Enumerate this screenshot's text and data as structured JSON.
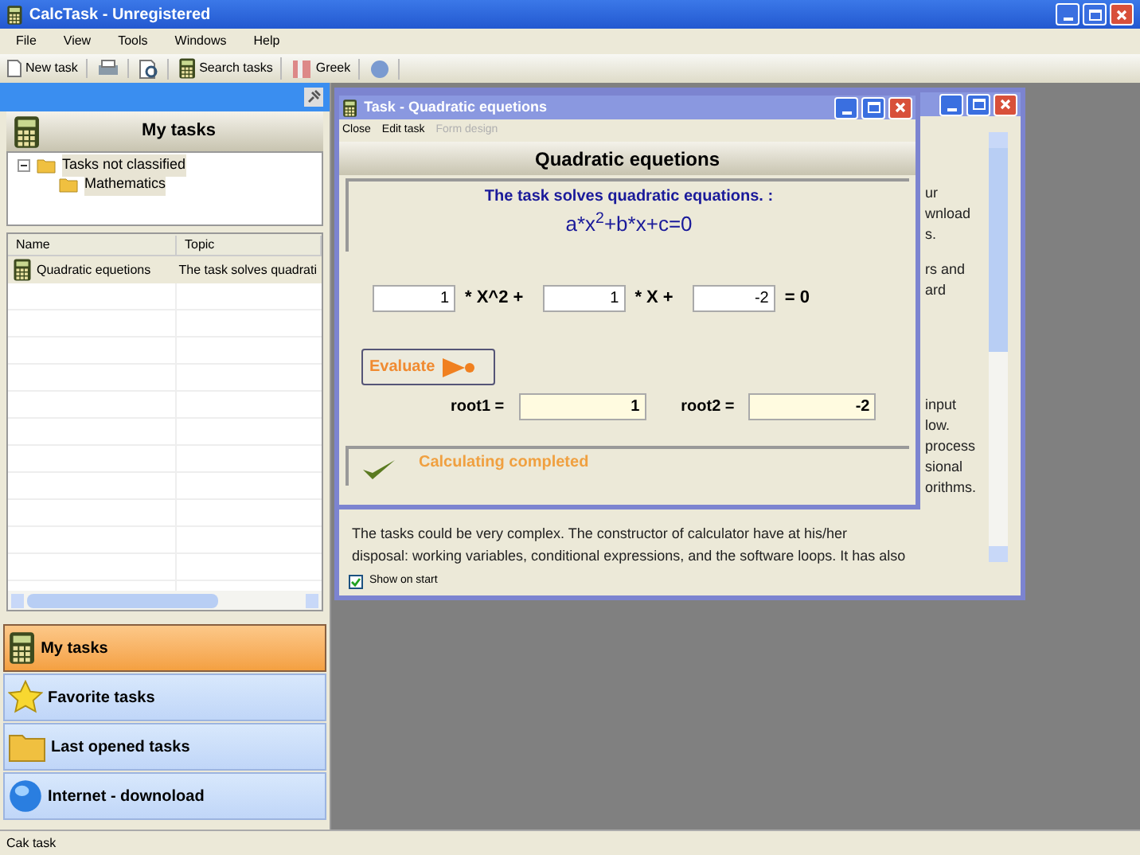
{
  "app": {
    "title": "CalcTask - Unregistered",
    "menu": [
      "File",
      "View",
      "Tools",
      "Windows",
      "Help"
    ],
    "toolbar": [
      {
        "kind": "doc",
        "label": "New task"
      },
      {
        "kind": "printer"
      },
      {
        "kind": "preview"
      },
      {
        "kind": "calc",
        "label": "Search tasks"
      },
      {
        "kind": "flag",
        "label": "Greek"
      },
      {
        "kind": "globe"
      }
    ]
  },
  "left_panel": {
    "header": "My tasks",
    "tree": [
      {
        "label": "Tasks not classified",
        "expanded": true,
        "children": [
          {
            "label": "Mathematics"
          }
        ]
      }
    ],
    "columns": [
      "Name",
      "Topic"
    ],
    "rows": [
      {
        "name": "Quadratic equetions",
        "topic": "The task solves quadrati"
      }
    ],
    "nav": [
      {
        "kind": "calc",
        "label": "My tasks",
        "selected": true
      },
      {
        "kind": "star",
        "label": "Favorite tasks",
        "selected": false
      },
      {
        "kind": "folder",
        "label": "Last opened tasks",
        "selected": false
      },
      {
        "kind": "globe",
        "label": "Internet - downoload",
        "selected": false
      }
    ]
  },
  "back_window": {
    "fragments": [
      "ur",
      "wnload",
      "s.",
      "rs and",
      "ard",
      "input",
      "low.",
      "process",
      "sional",
      "orithms."
    ],
    "lines": [
      "The tasks could be very complex. The constructor of calculator have at his/her",
      "disposal: working variables, conditional expressions, and the software loops. It has also"
    ],
    "show_on_start": {
      "label": "Show on start",
      "checked": true
    }
  },
  "task_window": {
    "title": "Task - Quadratic equetions",
    "menu": [
      {
        "label": "Close",
        "disabled": false
      },
      {
        "label": "Edit task",
        "disabled": false
      },
      {
        "label": "Form design",
        "disabled": true
      }
    ],
    "heading": "Quadratic equetions",
    "description": "The task solves quadratic equations. :",
    "formula": "a*x$^{2}$+b*x+c=0",
    "equation": [
      {
        "kind": "input",
        "value": "1"
      },
      {
        "kind": "text",
        "value": "* X^2 +"
      },
      {
        "kind": "input",
        "value": "1"
      },
      {
        "kind": "text",
        "value": "* X +"
      },
      {
        "kind": "input",
        "value": "-2"
      },
      {
        "kind": "text",
        "value": "= 0"
      }
    ],
    "evaluate": "Evaluate",
    "roots": [
      {
        "label": "root1 =",
        "value": "1"
      },
      {
        "label": "root2 =",
        "value": "-2"
      }
    ],
    "status": "Calculating completed"
  },
  "status_bar": "Cak task"
}
